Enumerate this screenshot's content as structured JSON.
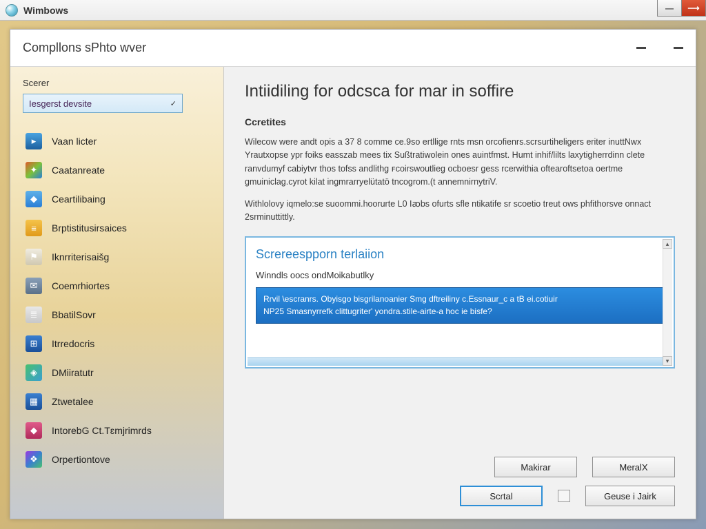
{
  "titlebar": {
    "title": "Wimbows"
  },
  "header": {
    "title": "Compllons sPhto wver"
  },
  "sidebar": {
    "section_label": "Scerer",
    "select_value": "Iesgerst devsite",
    "items": [
      {
        "label": "Vaan licter",
        "icon_bg": "linear-gradient(#4aa3e0,#1b5f9e)",
        "glyph": "▸"
      },
      {
        "label": "Caatanreate",
        "icon_bg": "linear-gradient(135deg,#e05a2a,#7cc23a 50%,#2a7fd6 100%)",
        "glyph": "✦"
      },
      {
        "label": "Ceartilibaing",
        "icon_bg": "linear-gradient(#5fb1e8,#2a7fd6)",
        "glyph": "◆"
      },
      {
        "label": "Brptistitusirsaices",
        "icon_bg": "linear-gradient(#f5c34a,#e09a1a)",
        "glyph": "≡"
      },
      {
        "label": "Iknrriterisaišg",
        "icon_bg": "linear-gradient(#f0ece0,#d0c8b0)",
        "glyph": "⚑"
      },
      {
        "label": "Coemrhiortes",
        "icon_bg": "linear-gradient(#8aa0b8,#5a7088)",
        "glyph": "✉"
      },
      {
        "label": "BbatilSovr",
        "icon_bg": "linear-gradient(#e8e8e8,#c8c8c8)",
        "glyph": "≣"
      },
      {
        "label": "Itrredocris",
        "icon_bg": "linear-gradient(#3a7fd0,#1a4f98)",
        "glyph": "⊞"
      },
      {
        "label": "DMiiratutr",
        "icon_bg": "linear-gradient(135deg,#48c070,#3a9fd0)",
        "glyph": "◈"
      },
      {
        "label": "Ztwetalee",
        "icon_bg": "linear-gradient(#3a7fd0,#1a4f98)",
        "glyph": "▦"
      },
      {
        "label": "IntorebG Ct.Tɛmjrimrds",
        "icon_bg": "linear-gradient(#e05a8a,#b02a5a)",
        "glyph": "◆"
      },
      {
        "label": "Orpertiontove",
        "icon_bg": "linear-gradient(135deg,#9a3ae0,#3a7fd0 50%,#48c070 100%)",
        "glyph": "❖"
      }
    ]
  },
  "main": {
    "heading": "Intiidiling for odcsca for mar in soffire",
    "subheading": "Ccretites",
    "para1": "Wilecow were andt opis a 37 8 comme ce.9so ertllige rnts msn orcofienrs.scrsurtiheligers eriter inuttNwx Yrautxopse ypr foiks easszab mees tix Sußtratiwolein ones auintfmst. Humt inhif/lilts laxytigherrdinn clete ranvdumyf cabiytvr thos tofss andlithg ꜰcoirswoutlieg ocboesr gess rcerwithia oftearoftsetoa oertme gmuiniclag.cyrot kilat ingmrarryelütatö tncogrom.(t annemnirnytriV.",
    "para2": "Withlolovy iqmelo:se suoommi.hoorurte L0 Iꜵbs ofurts sfle ntikatife sr scoetio treut ows phfithorsve onnact 2srminuttittly.",
    "panel": {
      "title": "Screreespporn terlaiion",
      "line": "Winndls oocs ondMoikabutlky",
      "highlight_l1": "Rrvil \\escranrs. Obyisgo bisgrilanoanier Smg dftreiliny c.Essnaur_c a tB ei.cotiuir",
      "highlight_l2": "NP25 Smasnyrrefk clittugriter' yondra.stile-airte-a hoc ie bisfe?"
    },
    "buttons": {
      "maker": "Makirar",
      "menax": "MeralX",
      "serial": "Scɾtal",
      "cancel": "Geuse i Jairk"
    }
  }
}
